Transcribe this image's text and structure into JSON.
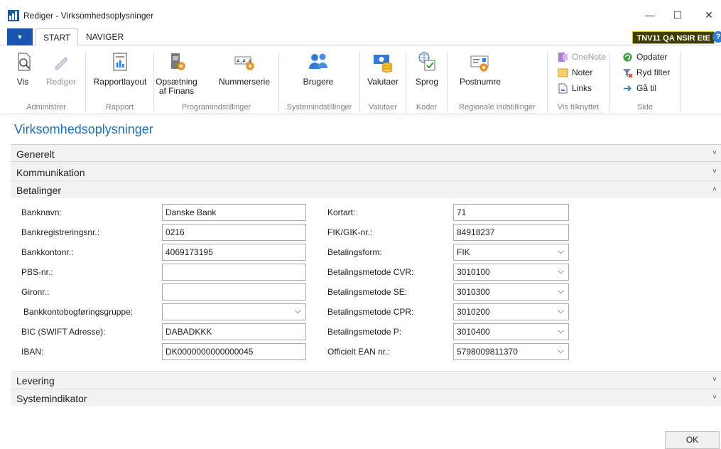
{
  "window": {
    "title": "Rediger - Virksomhedsoplysninger",
    "minimize_glyph": "—",
    "maximize_glyph": "☐",
    "close_glyph": "✕"
  },
  "ribbon_tabs": {
    "file_glyph": "▼",
    "start": "START",
    "naviger": "NAVIGER",
    "company": "TNV11 QA NSIR EtE",
    "help_glyph": "?"
  },
  "ribbon": {
    "administrer": {
      "label": "Administrer",
      "vis": "Vis",
      "rediger": "Rediger"
    },
    "rapport": {
      "label": "Rapport",
      "rapportlayout": "Rapportlayout"
    },
    "programindstillinger": {
      "label": "Programindstillinger",
      "opsaetning_line1": "Opsætning",
      "opsaetning_line2": "af Finans",
      "nummerserie": "Nummerserie"
    },
    "systemindstillinger": {
      "label": "Systemindstillinger",
      "brugere": "Brugere"
    },
    "valutaer": {
      "label": "Valutaer",
      "valutaer": "Valutaer"
    },
    "koder": {
      "label": "Koder",
      "sprog": "Sprog"
    },
    "regionale": {
      "label": "Regionale indstillinger",
      "postnumre": "Postnumre"
    },
    "vis_tilknyttet": {
      "label": "Vis tilknyttet",
      "onenote": "OneNote",
      "noter": "Noter",
      "links": "Links"
    },
    "side": {
      "label": "Side",
      "opdater": "Opdater",
      "ryd_filter": "Ryd filter",
      "gaa_til": "Gå til"
    }
  },
  "page": {
    "title": "Virksomhedsoplysninger",
    "chevron_down": "˅",
    "chevron_up": "˄"
  },
  "fasttabs": {
    "generelt": "Generelt",
    "kommunikation": "Kommunikation",
    "betalinger": "Betalinger",
    "levering": "Levering",
    "systemindikator": "Systemindikator"
  },
  "fields_left": [
    {
      "label": "Banknavn:",
      "value": "Danske Bank",
      "dropdown": false
    },
    {
      "label": "Bankregistreringsnr.:",
      "value": "0216",
      "dropdown": false
    },
    {
      "label": "Bankkontonr.:",
      "value": "4069173195",
      "dropdown": false
    },
    {
      "label": "PBS-nr.:",
      "value": "",
      "dropdown": false
    },
    {
      "label": "Gironr.:",
      "value": "",
      "dropdown": false
    },
    {
      "label": "Bankkontobogføringsgruppe:",
      "value": "",
      "dropdown": true
    },
    {
      "label": "BIC (SWIFT Adresse):",
      "value": "DABADKKK",
      "dropdown": false
    },
    {
      "label": "IBAN:",
      "value": "DK0000000000000045",
      "dropdown": false
    }
  ],
  "fields_right": [
    {
      "label": "Kortart:",
      "value": "71",
      "dropdown": false
    },
    {
      "label": "FIK/GIK-nr.:",
      "value": "84918237",
      "dropdown": false
    },
    {
      "label": "Betalingsform:",
      "value": "FIK",
      "dropdown": true
    },
    {
      "label": "Betalingsmetode CVR:",
      "value": "3010100",
      "dropdown": true
    },
    {
      "label": "Betalingsmetode SE:",
      "value": "3010300",
      "dropdown": true
    },
    {
      "label": "Betalingsmetode CPR:",
      "value": "3010200",
      "dropdown": true
    },
    {
      "label": "Betalingsmetode P:",
      "value": "3010400",
      "dropdown": true
    },
    {
      "label": "Officielt EAN nr.:",
      "value": "5798009811370",
      "dropdown": true
    }
  ],
  "dropdown_glyph": "⌵",
  "footer": {
    "ok": "OK"
  },
  "colors": {
    "accent": "#1e6fb8",
    "file_button": "#1a56b0",
    "company_badge": "#3d3d00"
  }
}
